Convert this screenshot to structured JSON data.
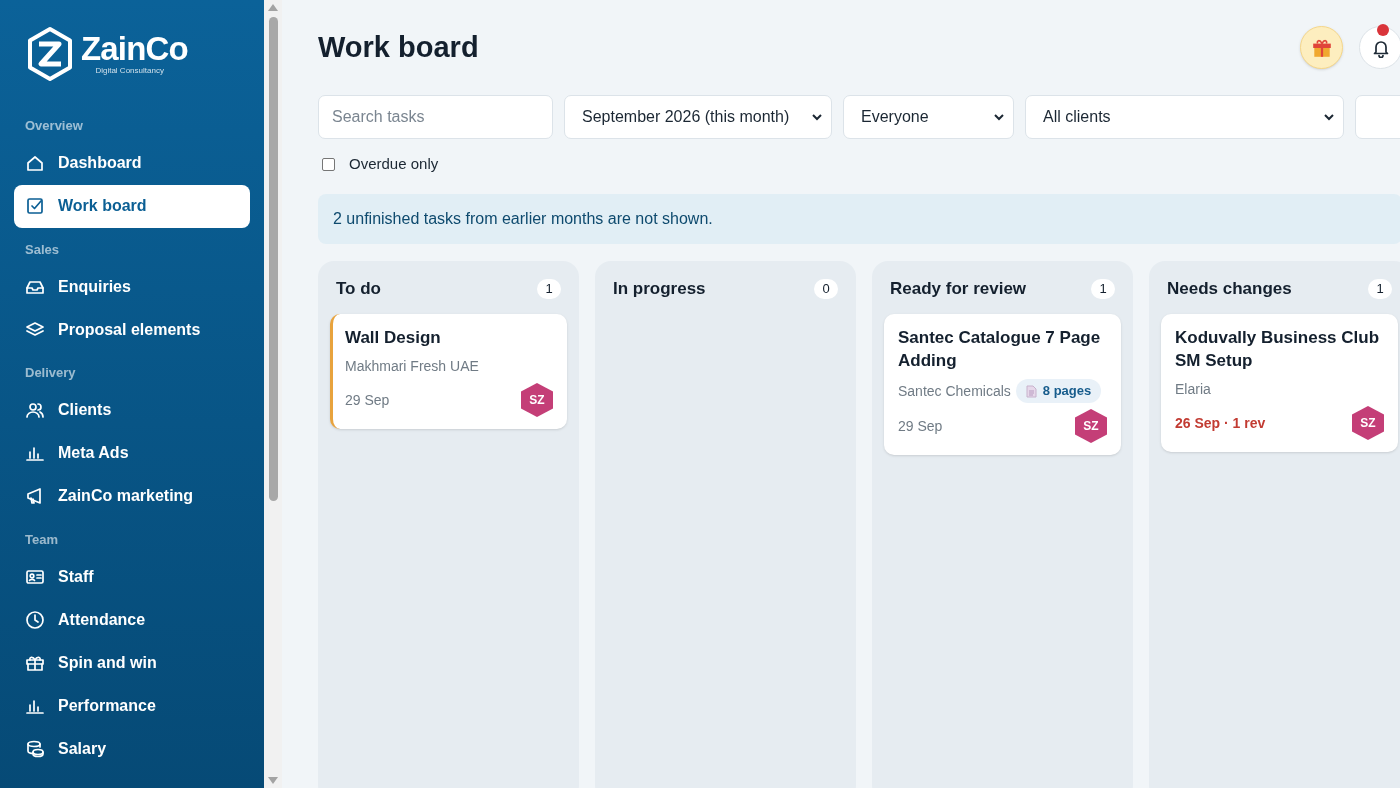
{
  "brand": {
    "name": "ZainCo",
    "tagline": "Digital Consultancy"
  },
  "sidebar": {
    "sections": [
      {
        "label": "Overview",
        "items": [
          {
            "label": "Dashboard",
            "selected": false
          },
          {
            "label": "Work board",
            "selected": true
          }
        ]
      },
      {
        "label": "Sales",
        "items": [
          {
            "label": "Enquiries",
            "selected": false
          },
          {
            "label": "Proposal elements",
            "selected": false
          }
        ]
      },
      {
        "label": "Delivery",
        "items": [
          {
            "label": "Clients",
            "selected": false
          },
          {
            "label": "Meta Ads",
            "selected": false
          },
          {
            "label": "ZainCo marketing",
            "selected": false
          }
        ]
      },
      {
        "label": "Team",
        "items": [
          {
            "label": "Staff",
            "selected": false
          },
          {
            "label": "Attendance",
            "selected": false
          },
          {
            "label": "Spin and win",
            "selected": false
          },
          {
            "label": "Performance",
            "selected": false
          },
          {
            "label": "Salary",
            "selected": false
          }
        ]
      }
    ]
  },
  "page": {
    "title": "Work board"
  },
  "notifications": {
    "unread": true
  },
  "filters": {
    "search_placeholder": "Search tasks",
    "selects": [
      "September 2026 (this month)",
      "Everyone",
      "All clients"
    ],
    "overdue_only": {
      "label": "Overdue only",
      "checked": false
    }
  },
  "notice": "2 unfinished tasks from earlier months are not shown.",
  "columns": [
    {
      "title": "To do",
      "count": "1",
      "cards": [
        {
          "title": "Wall Design",
          "client": "Makhmari Fresh UAE",
          "date": "29 Sep",
          "overdue": false,
          "color": "#e8a33d",
          "assignee": "SZ"
        }
      ]
    },
    {
      "title": "In progress",
      "count": "0"
    },
    {
      "title": "Ready for review",
      "count": "1",
      "cards": [
        {
          "title": "Santec Catalogue 7 Page Adding",
          "client": "Santec Chemicals",
          "pages": "8 pages",
          "date": "29 Sep",
          "overdue": false,
          "assignee": "SZ"
        }
      ]
    },
    {
      "title": "Needs changes",
      "count": "1",
      "cards": [
        {
          "title": "Koduvally Business Club SM Setup",
          "client": "Elaria",
          "date": "26 Sep · 1 rev",
          "overdue": true,
          "assignee": "SZ"
        }
      ]
    }
  ]
}
